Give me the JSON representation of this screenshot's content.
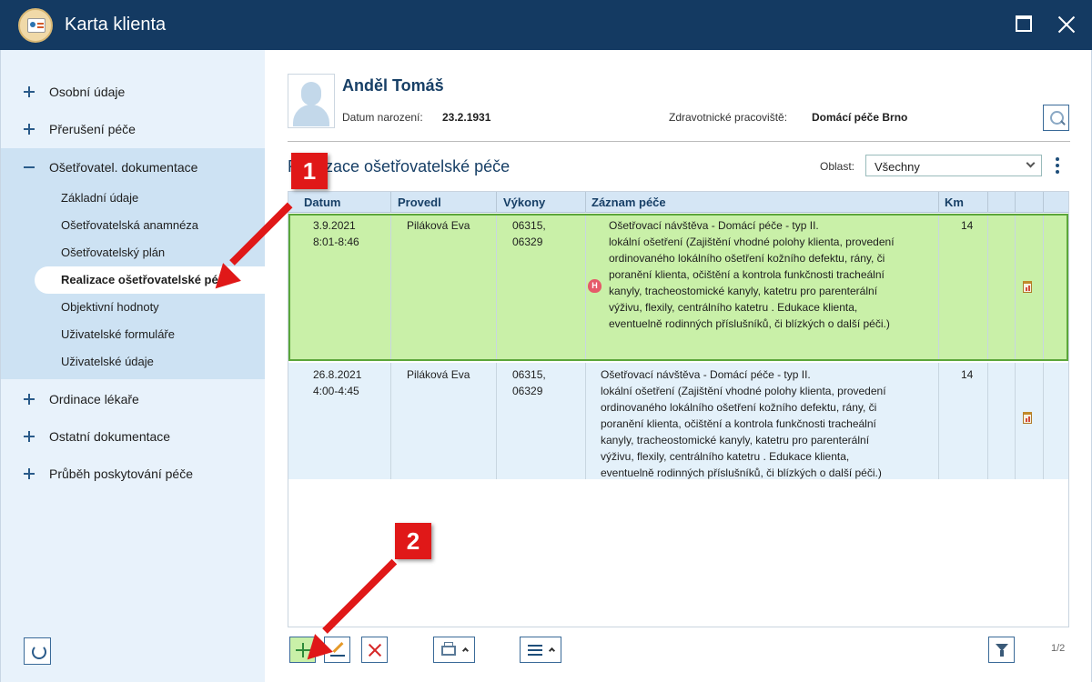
{
  "window": {
    "title": "Karta klienta"
  },
  "sidebar": {
    "items": [
      {
        "label": "Osobní údaje",
        "state": "collapsed"
      },
      {
        "label": "Přerušení péče",
        "state": "collapsed"
      },
      {
        "label": "Ošetřovatel. dokumentace",
        "state": "expanded"
      },
      {
        "label": "Ordinace lékaře",
        "state": "collapsed"
      },
      {
        "label": "Ostatní dokumentace",
        "state": "collapsed"
      },
      {
        "label": "Průběh poskytování péče",
        "state": "collapsed"
      }
    ],
    "subitems": [
      {
        "label": "Základní údaje"
      },
      {
        "label": "Ošetřovatelská anamnéza"
      },
      {
        "label": "Ošetřovatelský plán"
      },
      {
        "label": "Realizace ošetřovatelské péče",
        "active": true
      },
      {
        "label": "Objektivní hodnoty"
      },
      {
        "label": "Uživatelské formuláře"
      },
      {
        "label": "Uživatelské údaje"
      }
    ]
  },
  "patient": {
    "name": "Anděl Tomáš",
    "dob_label": "Datum narození:",
    "dob": "23.2.1931",
    "workplace_label": "Zdravotnické pracoviště:",
    "workplace": "Domácí péče Brno"
  },
  "section": {
    "title": "Realizace ošetřovatelské péče",
    "area_label": "Oblast:",
    "area_value": "Všechny"
  },
  "table": {
    "columns": [
      "Datum",
      "Provedl",
      "Výkony",
      "Záznam péče",
      "Km"
    ],
    "rows": [
      {
        "date": "3.9.2021",
        "time": "8:01-8:46",
        "by": "Piláková Eva",
        "codes": [
          "06315,",
          "06329"
        ],
        "record": [
          "Ošetřovací návštěva - Domácí péče - typ II.",
          "lokální ošetření (Zajištění vhodné polohy klienta, provedení",
          "ordinovaného lokálního ošetření kožního defektu, rány, či",
          "poranění klienta, očištění a kontrola funkčnosti tracheální",
          "kanyly, tracheostomické kanyly, katetru pro parenterální",
          "výživu, flexily, centrálního katetru . Edukace klienta,",
          "eventuelně rodinných příslušníků, či blízkých o další péči.)"
        ],
        "km": "14",
        "selected": true
      },
      {
        "date": "26.8.2021",
        "time": "4:00-4:45",
        "by": "Piláková Eva",
        "codes": [
          "06315,",
          "06329"
        ],
        "record": [
          "Ošetřovací návštěva - Domácí péče - typ II.",
          "lokální ošetření (Zajištění vhodné polohy klienta, provedení",
          "ordinovaného lokálního ošetření kožního defektu, rány, či",
          "poranění klienta, očištění a kontrola funkčnosti tracheální",
          "kanyly, tracheostomické kanyly, katetru pro parenterální",
          "výživu, flexily, centrálního katetru . Edukace klienta,",
          "eventuelně rodinných příslušníků, či blízkých o další péči.)"
        ],
        "km": "14",
        "selected": false
      }
    ],
    "h_icon": "H"
  },
  "toolbar": {
    "page_info": "1/2"
  },
  "annotations": {
    "badge1": "1",
    "badge2": "2",
    "color": "#e01818"
  },
  "colors": {
    "titlebar": "#143a62",
    "sidebar": "#e8f2fb",
    "subpanel": "#cde2f3",
    "selected_row": "#c9f0a8",
    "selected_border": "#5ba63a",
    "header_row": "#d5e6f5"
  }
}
